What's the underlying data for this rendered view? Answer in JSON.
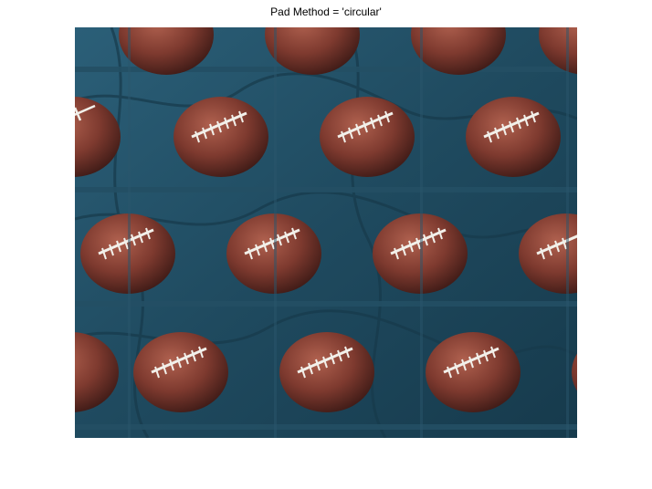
{
  "figure": {
    "title": "Pad Method = 'circular'"
  },
  "image": {
    "subject": "tiled football on blue cloth",
    "colors": {
      "cloth": "#1f4a5f",
      "ball": "#7e3a2f",
      "laces": "#f2f0ea"
    }
  }
}
